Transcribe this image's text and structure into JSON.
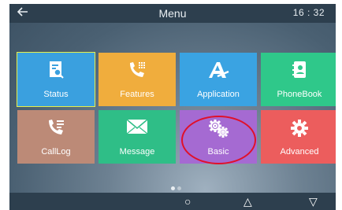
{
  "header": {
    "title": "Menu",
    "time": "16 : 32"
  },
  "tiles": [
    {
      "label": "Status"
    },
    {
      "label": "Features"
    },
    {
      "label": "Application"
    },
    {
      "label": "PhoneBook"
    },
    {
      "label": "CallLog"
    },
    {
      "label": "Message"
    },
    {
      "label": "Basic"
    },
    {
      "label": "Advanced"
    }
  ],
  "navbar": {
    "home": "○",
    "recent": "△",
    "back": "▽"
  },
  "icons": [
    "back-arrow-icon",
    "status-icon",
    "features-icon",
    "application-icon",
    "phonebook-icon",
    "calllog-icon",
    "message-icon",
    "basic-gear-icon",
    "advanced-gear-icon"
  ],
  "colors": {
    "status": "#3aa0df",
    "features": "#f0ad3d",
    "application": "#3aa3e2",
    "phonebook": "#2fc88a",
    "calllog": "#bc8a77",
    "message": "#2fbe87",
    "basic": "#a56ad2",
    "advanced": "#ec5d5d",
    "highlight_ring": "#e0102a"
  }
}
